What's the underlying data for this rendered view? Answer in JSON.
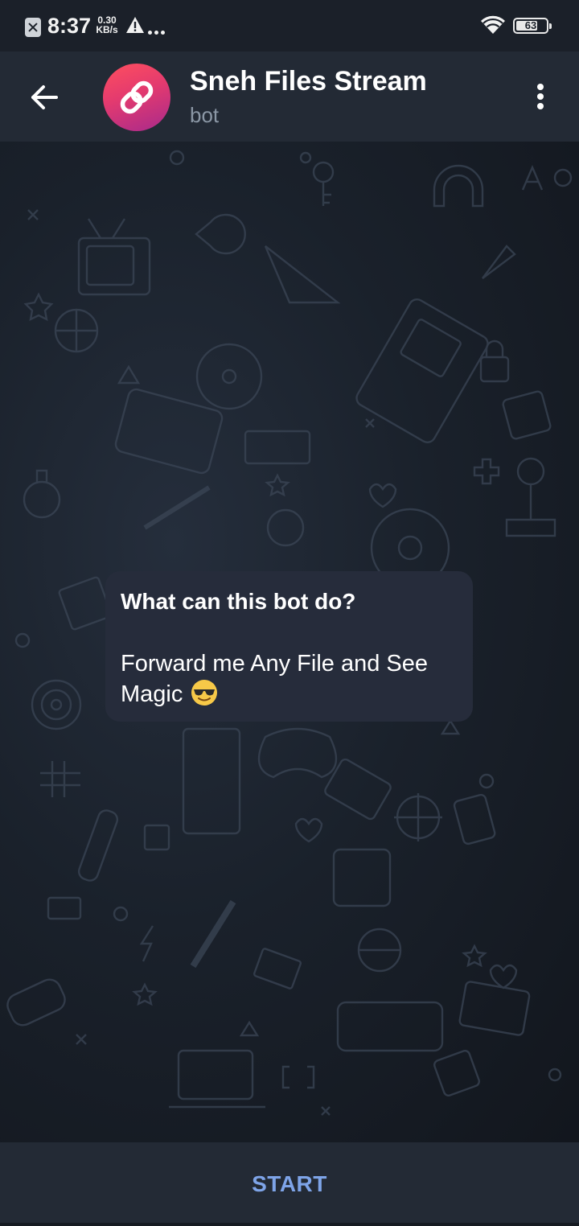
{
  "status_bar": {
    "time": "8:37",
    "speed_value": "0.30",
    "speed_unit": "KB/s",
    "battery_level": "63",
    "icons": [
      "sim-off-icon",
      "warning-icon",
      "more-dots-icon",
      "wifi-icon",
      "battery-icon"
    ]
  },
  "header": {
    "title": "Sneh Files Stream",
    "subtitle": "bot",
    "back_icon": "arrow-left-icon",
    "avatar_icon": "link-icon",
    "menu_icon": "vertical-dots-icon",
    "avatar_gradient": [
      "#ff4f5e",
      "#a82a8c"
    ]
  },
  "chat": {
    "info_title": "What can this bot do?",
    "info_body": "Forward me Any File and See Magic",
    "info_emoji": "sunglasses-emoji"
  },
  "bottom": {
    "start_label": "START"
  },
  "colors": {
    "accent": "#7ea4e8",
    "header_bg": "#232a35",
    "bubble_bg": "#262c3b",
    "subtitle": "#8b97a5"
  }
}
